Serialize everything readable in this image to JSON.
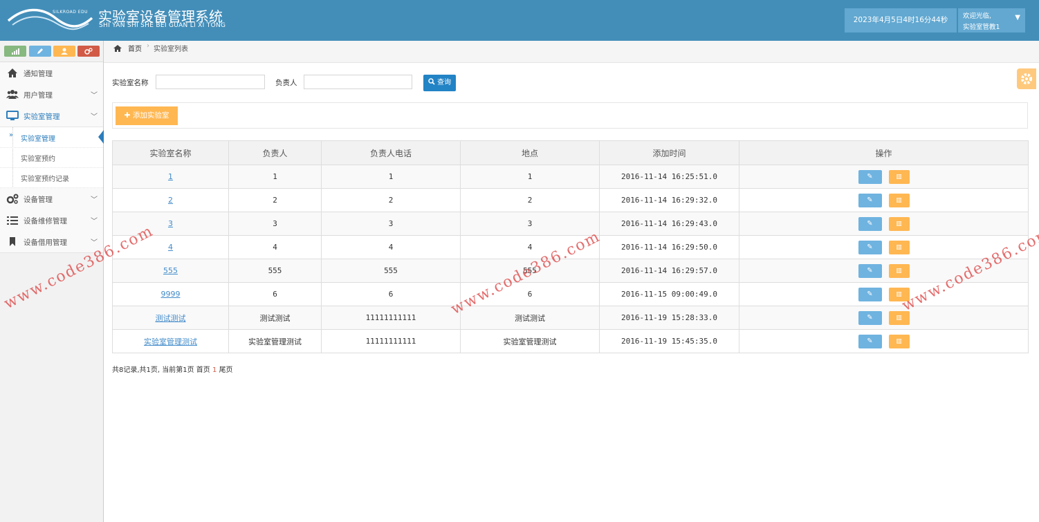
{
  "header": {
    "logo_text": "SILKROAD EDU",
    "app_title": "实验室设备管理系统",
    "app_subtitle": "SHI YAN SHI SHE BEI GUAN LI XI TONG",
    "datetime": "2023年4月5日4时16分44秒",
    "welcome": "欢迎光临,",
    "username": "实验室管教1"
  },
  "sidebar": {
    "items": [
      {
        "label": "通知管理",
        "icon": "home-icon"
      },
      {
        "label": "用户管理",
        "icon": "users-icon"
      },
      {
        "label": "实验室管理",
        "icon": "desktop-icon"
      },
      {
        "label": "设备管理",
        "icon": "cogs-icon"
      },
      {
        "label": "设备维修管理",
        "icon": "list-icon"
      },
      {
        "label": "设备借用管理",
        "icon": "bookmark-icon"
      }
    ],
    "submenu": [
      "实验室管理",
      "实验室预约",
      "实验室预约记录"
    ]
  },
  "breadcrumb": {
    "home": "首页",
    "current": "实验室列表"
  },
  "search": {
    "name_label": "实验室名称",
    "owner_label": "负责人",
    "query_label": "查询",
    "name_value": "",
    "owner_value": ""
  },
  "add_button_label": "添加实验室",
  "table": {
    "headers": [
      "实验室名称",
      "负责人",
      "负责人电话",
      "地点",
      "添加时间",
      "操作"
    ],
    "rows": [
      [
        "1",
        "1",
        "1",
        "1",
        "2016-11-14 16:25:51.0"
      ],
      [
        "2",
        "2",
        "2",
        "2",
        "2016-11-14 16:29:32.0"
      ],
      [
        "3",
        "3",
        "3",
        "3",
        "2016-11-14 16:29:43.0"
      ],
      [
        "4",
        "4",
        "4",
        "4",
        "2016-11-14 16:29:50.0"
      ],
      [
        "555",
        "555",
        "555",
        "555",
        "2016-11-14 16:29:57.0"
      ],
      [
        "9999",
        "6",
        "6",
        "6",
        "2016-11-15 09:00:49.0"
      ],
      [
        "测试测试",
        "测试测试",
        "11111111111",
        "测试测试",
        "2016-11-19 15:28:33.0"
      ],
      [
        "实验室管理测试",
        "实验室管理测试",
        "11111111111",
        "实验室管理测试",
        "2016-11-19 15:45:35.0"
      ]
    ]
  },
  "pagination": {
    "summary": "共8记录,共1页, 当前第1页 首页",
    "current": "1",
    "last": "尾页"
  },
  "watermark": "www.code386.com",
  "colors": {
    "header": "#438eb9",
    "primary": "#2283c5",
    "warning": "#ffb752",
    "info": "#6fb3e0"
  }
}
